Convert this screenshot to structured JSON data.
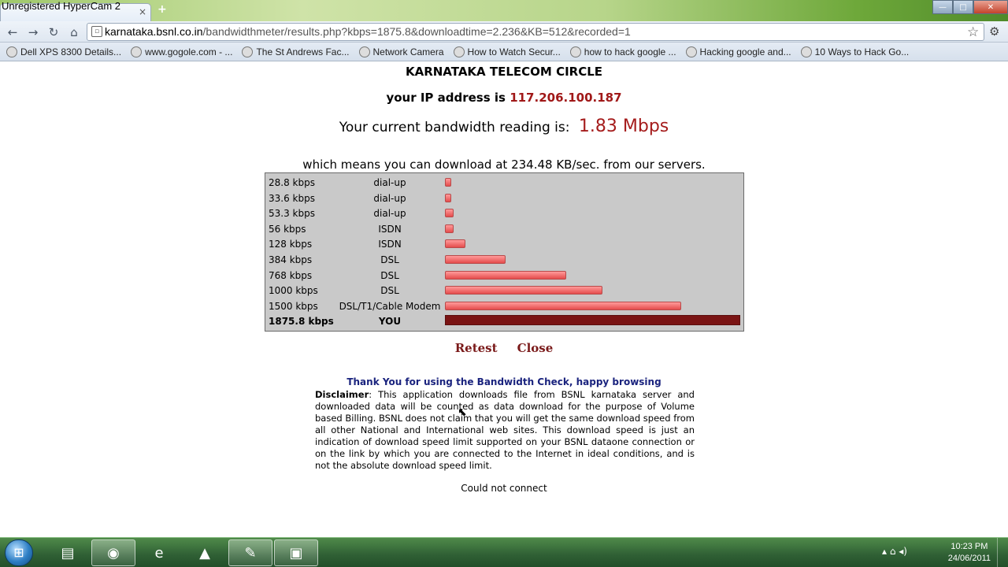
{
  "window": {
    "watermark": "Unregistered HyperCam 2",
    "tab_close": "×",
    "new_tab": "+",
    "minimize": "—",
    "maximize": "□",
    "close": "✕"
  },
  "toolbar": {
    "url_host": "karnataka.bsnl.co.in",
    "url_path": "/bandwidthmeter/results.php?kbps=1875.8&downloadtime=2.236&KB=512&recorded=1"
  },
  "bookmarks": [
    {
      "label": "Dell XPS 8300 Details..."
    },
    {
      "label": "www.gogole.com - ..."
    },
    {
      "label": "The St Andrews Fac..."
    },
    {
      "label": "Network Camera"
    },
    {
      "label": "How to Watch Secur..."
    },
    {
      "label": "how to hack google ..."
    },
    {
      "label": "Hacking google and..."
    },
    {
      "label": "10 Ways to Hack Go..."
    }
  ],
  "page": {
    "org": "KARNATAKA TELECOM CIRCLE",
    "ip_label": "your IP address is",
    "ip_value": "117.206.100.187",
    "bw_label": "Your current bandwidth reading is:",
    "bw_value": "1.83 Mbps",
    "download_line": "which means you can download at 234.48 KB/sec. from our servers.",
    "retest": "Retest",
    "close": "Close",
    "thanks": "Thank You for using the Bandwidth Check, happy browsing",
    "disclaimer_label": "Disclaimer",
    "disclaimer_text": ": This application downloads file from BSNL karnataka server and downloaded data will be counted as data download for the purpose of Volume based Billing. BSNL does not claim that you will get the same download speed from all other National and International web sites. This download speed is just an indication of download speed limit supported on your BSNL dataone connection or on the link by which you are connected to the Internet in ideal conditions, and is not the absolute download speed limit.",
    "no_connect": "Could not connect"
  },
  "chart_data": {
    "type": "bar",
    "max_kbps": 1875.8,
    "rows": [
      {
        "speed": "28.8 kbps",
        "type": "dial-up",
        "kbps": 28.8
      },
      {
        "speed": "33.6 kbps",
        "type": "dial-up",
        "kbps": 33.6
      },
      {
        "speed": "53.3 kbps",
        "type": "dial-up",
        "kbps": 53.3
      },
      {
        "speed": "56 kbps",
        "type": "ISDN",
        "kbps": 56
      },
      {
        "speed": "128 kbps",
        "type": "ISDN",
        "kbps": 128
      },
      {
        "speed": "384 kbps",
        "type": "DSL",
        "kbps": 384
      },
      {
        "speed": "768 kbps",
        "type": "DSL",
        "kbps": 768
      },
      {
        "speed": "1000 kbps",
        "type": "DSL",
        "kbps": 1000
      },
      {
        "speed": "1500 kbps",
        "type": "DSL/T1/Cable Modem",
        "kbps": 1500
      },
      {
        "speed": "1875.8 kbps",
        "type": "YOU",
        "kbps": 1875.8,
        "highlight": true
      }
    ]
  },
  "taskbar": {
    "apps": [
      {
        "name": "explorer",
        "glyph": "▤"
      },
      {
        "name": "chrome",
        "glyph": "◉"
      },
      {
        "name": "ie",
        "glyph": "e"
      },
      {
        "name": "vlc",
        "glyph": "▲"
      },
      {
        "name": "hypercam",
        "glyph": "✎"
      },
      {
        "name": "other",
        "glyph": "▣"
      }
    ],
    "tray_icons": "▴  ⌂  ◂)",
    "time": "10:23 PM",
    "date": "24/06/2011"
  }
}
